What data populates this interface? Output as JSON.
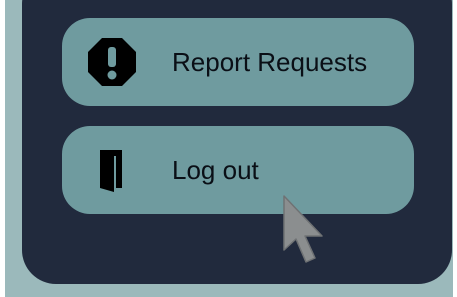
{
  "menu": {
    "report": {
      "label": "Report Requests",
      "icon": "octagon-alert-icon"
    },
    "logout": {
      "label": "Log out",
      "icon": "door-exit-icon"
    }
  },
  "colors": {
    "panel": "#212a3d",
    "button": "#6f9b9f",
    "frame": "#9bb9bb",
    "text": "#0a0f16",
    "cursor": "#8b8e8f"
  }
}
